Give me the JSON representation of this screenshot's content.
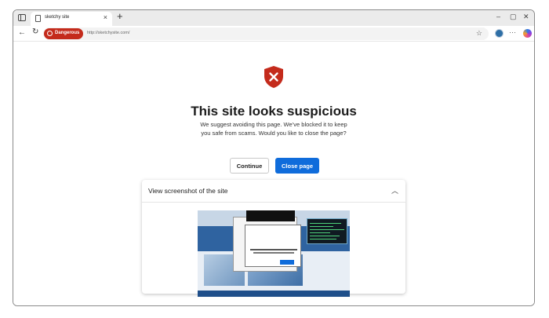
{
  "browser": {
    "tab_title": "sketchy site",
    "new_tab_symbol": "+",
    "tab_close_symbol": "×",
    "window_controls": {
      "minimize": "–",
      "maximize": "▢",
      "close": "✕"
    },
    "address": {
      "badge_label": "Dangerous",
      "url": "http://sketchysite.com/"
    },
    "toolbar_more": "···"
  },
  "warning": {
    "heading": "This site looks suspicious",
    "body": "We suggest avoiding this page. We’ve blocked it to keep you safe from scams. Would you like to close the page?",
    "continue_label": "Continue",
    "close_label": "Close page"
  },
  "screenshot_card": {
    "title": "View screenshot of the site",
    "chevron": "︿"
  },
  "colors": {
    "danger": "#c42b1c",
    "accent": "#0f6cdb",
    "shield": "#c42b1c"
  }
}
